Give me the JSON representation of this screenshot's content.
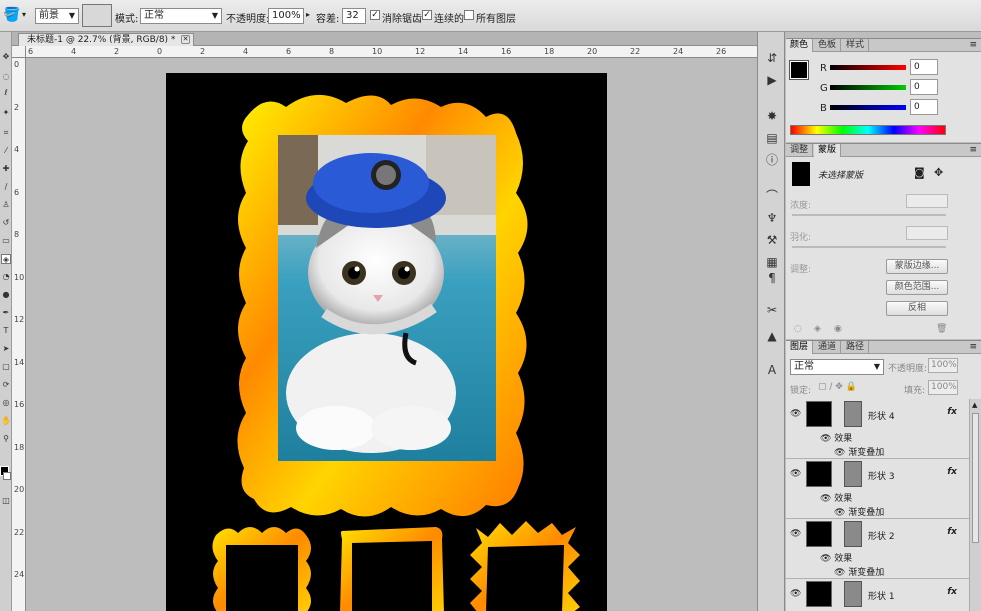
{
  "options": {
    "preset": "前景",
    "mode_label": "模式:",
    "mode_value": "正常",
    "opacity_label": "不透明度:",
    "opacity_value": "100%",
    "tolerance_label": "容差:",
    "tolerance_value": "32",
    "antialias_label": "消除锯齿",
    "contiguous_label": "连续的",
    "all_layers_label": "所有图层"
  },
  "document": {
    "tab_title": "未标题-1 @ 22.7% (背景, RGB/8) *",
    "ruler_h": [
      "6",
      "4",
      "2",
      "0",
      "2",
      "4",
      "6",
      "8",
      "10",
      "12",
      "14",
      "16",
      "18",
      "20",
      "22",
      "24",
      "26"
    ],
    "ruler_v": [
      "0",
      "2",
      "4",
      "6",
      "8",
      "10",
      "12",
      "14",
      "16",
      "18",
      "20",
      "22",
      "24"
    ]
  },
  "color_panel": {
    "tabs": [
      "颜色",
      "色板",
      "样式"
    ],
    "r_label": "R",
    "g_label": "G",
    "b_label": "B",
    "r_value": "0",
    "g_value": "0",
    "b_value": "0"
  },
  "mask_panel": {
    "tabs": [
      "调整",
      "蒙版"
    ],
    "status": "未选择蒙版",
    "density_label": "浓度:",
    "feather_label": "羽化:",
    "adjust_label": "调整:",
    "btn_edge": "蒙版边缘...",
    "btn_color_range": "颜色范围...",
    "btn_invert": "反相"
  },
  "layers_panel": {
    "tabs": [
      "图层",
      "通道",
      "路径"
    ],
    "blend_mode": "正常",
    "opacity_label": "不透明度:",
    "opacity_value": "100%",
    "lock_label": "锁定:",
    "fill_label": "填充:",
    "fill_value": "100%",
    "effects_label": "效果",
    "gradient_label": "渐变叠加",
    "fx_label": "fx",
    "layers": [
      {
        "name": "形状 4"
      },
      {
        "name": "形状 3"
      },
      {
        "name": "形状 2"
      },
      {
        "name": "形状 1"
      }
    ]
  }
}
